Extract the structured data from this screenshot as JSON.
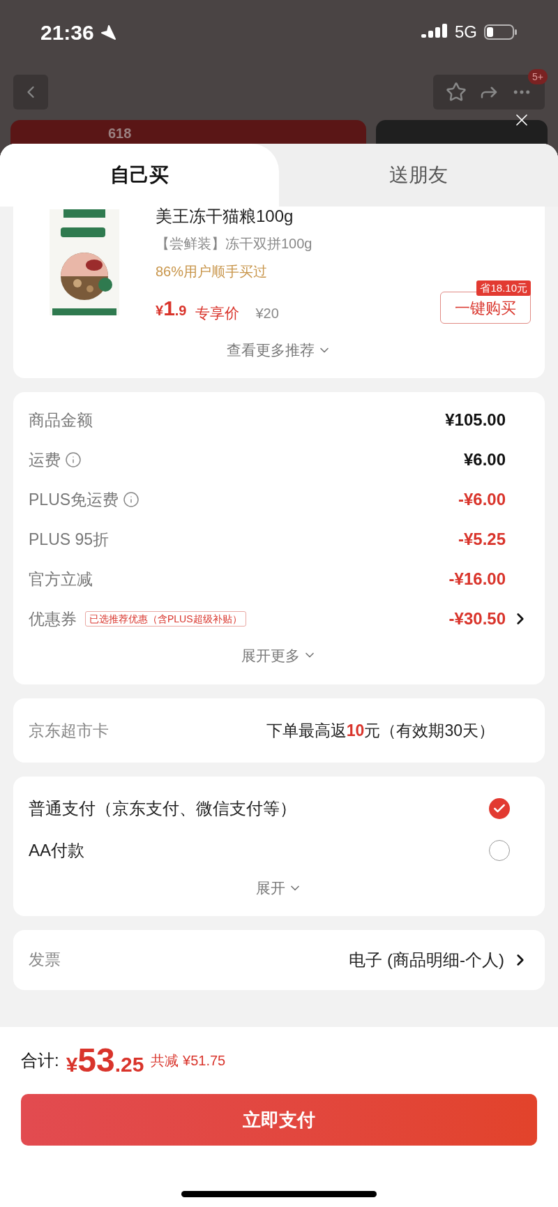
{
  "status_bar": {
    "time": "21:36",
    "network": "5G"
  },
  "nav": {
    "badge": "5+"
  },
  "banner": {
    "text": "618"
  },
  "tabs": [
    {
      "label": "自己买",
      "selected": true
    },
    {
      "label": "送朋友",
      "selected": false
    }
  ],
  "recommendation": {
    "title": "美王冻干猫粮100g",
    "variant": "【尝鲜装】冻干双拼100g",
    "social_proof": "86%用户顺手买过",
    "price_symbol": "¥",
    "price_int": "1",
    "price_dec": ".9",
    "price_label": "专享价",
    "original_price": "¥20",
    "saving_tag": "省18.10元",
    "buy_button": "一键购买",
    "more_link": "查看更多推荐"
  },
  "fees": [
    {
      "label": "商品金额",
      "info": false,
      "value": "¥105.00",
      "kind": "charge",
      "link": false
    },
    {
      "label": "运费",
      "info": true,
      "value": "¥6.00",
      "kind": "charge",
      "link": false
    },
    {
      "label": "PLUS免运费",
      "info": true,
      "value": "-¥6.00",
      "kind": "discount",
      "link": false
    },
    {
      "label": "PLUS 95折",
      "info": false,
      "value": "-¥5.25",
      "kind": "discount",
      "link": false
    },
    {
      "label": "官方立减",
      "info": false,
      "value": "-¥16.00",
      "kind": "discount",
      "link": false
    },
    {
      "label": "优惠券",
      "info": false,
      "tag": "已选推荐优惠（含PLUS超级补贴）",
      "value": "-¥30.50",
      "kind": "discount",
      "link": true
    }
  ],
  "expand_more": "展开更多",
  "supermarket_card": {
    "label": "京东超市卡",
    "prefix": "下单最高返",
    "highlight": "10",
    "suffix": "元（有效期30天）"
  },
  "payment_methods": [
    {
      "label": "普通支付（京东支付、微信支付等）",
      "selected": true
    },
    {
      "label": "AA付款",
      "selected": false
    }
  ],
  "payment_expand": "展开",
  "invoice": {
    "label": "发票",
    "value": "电子 (商品明细-个人)"
  },
  "total": {
    "label": "合计:",
    "symbol": "¥",
    "int": "53",
    "dec": ".25",
    "saving": "共减 ¥51.75"
  },
  "pay_button": "立即支付"
}
